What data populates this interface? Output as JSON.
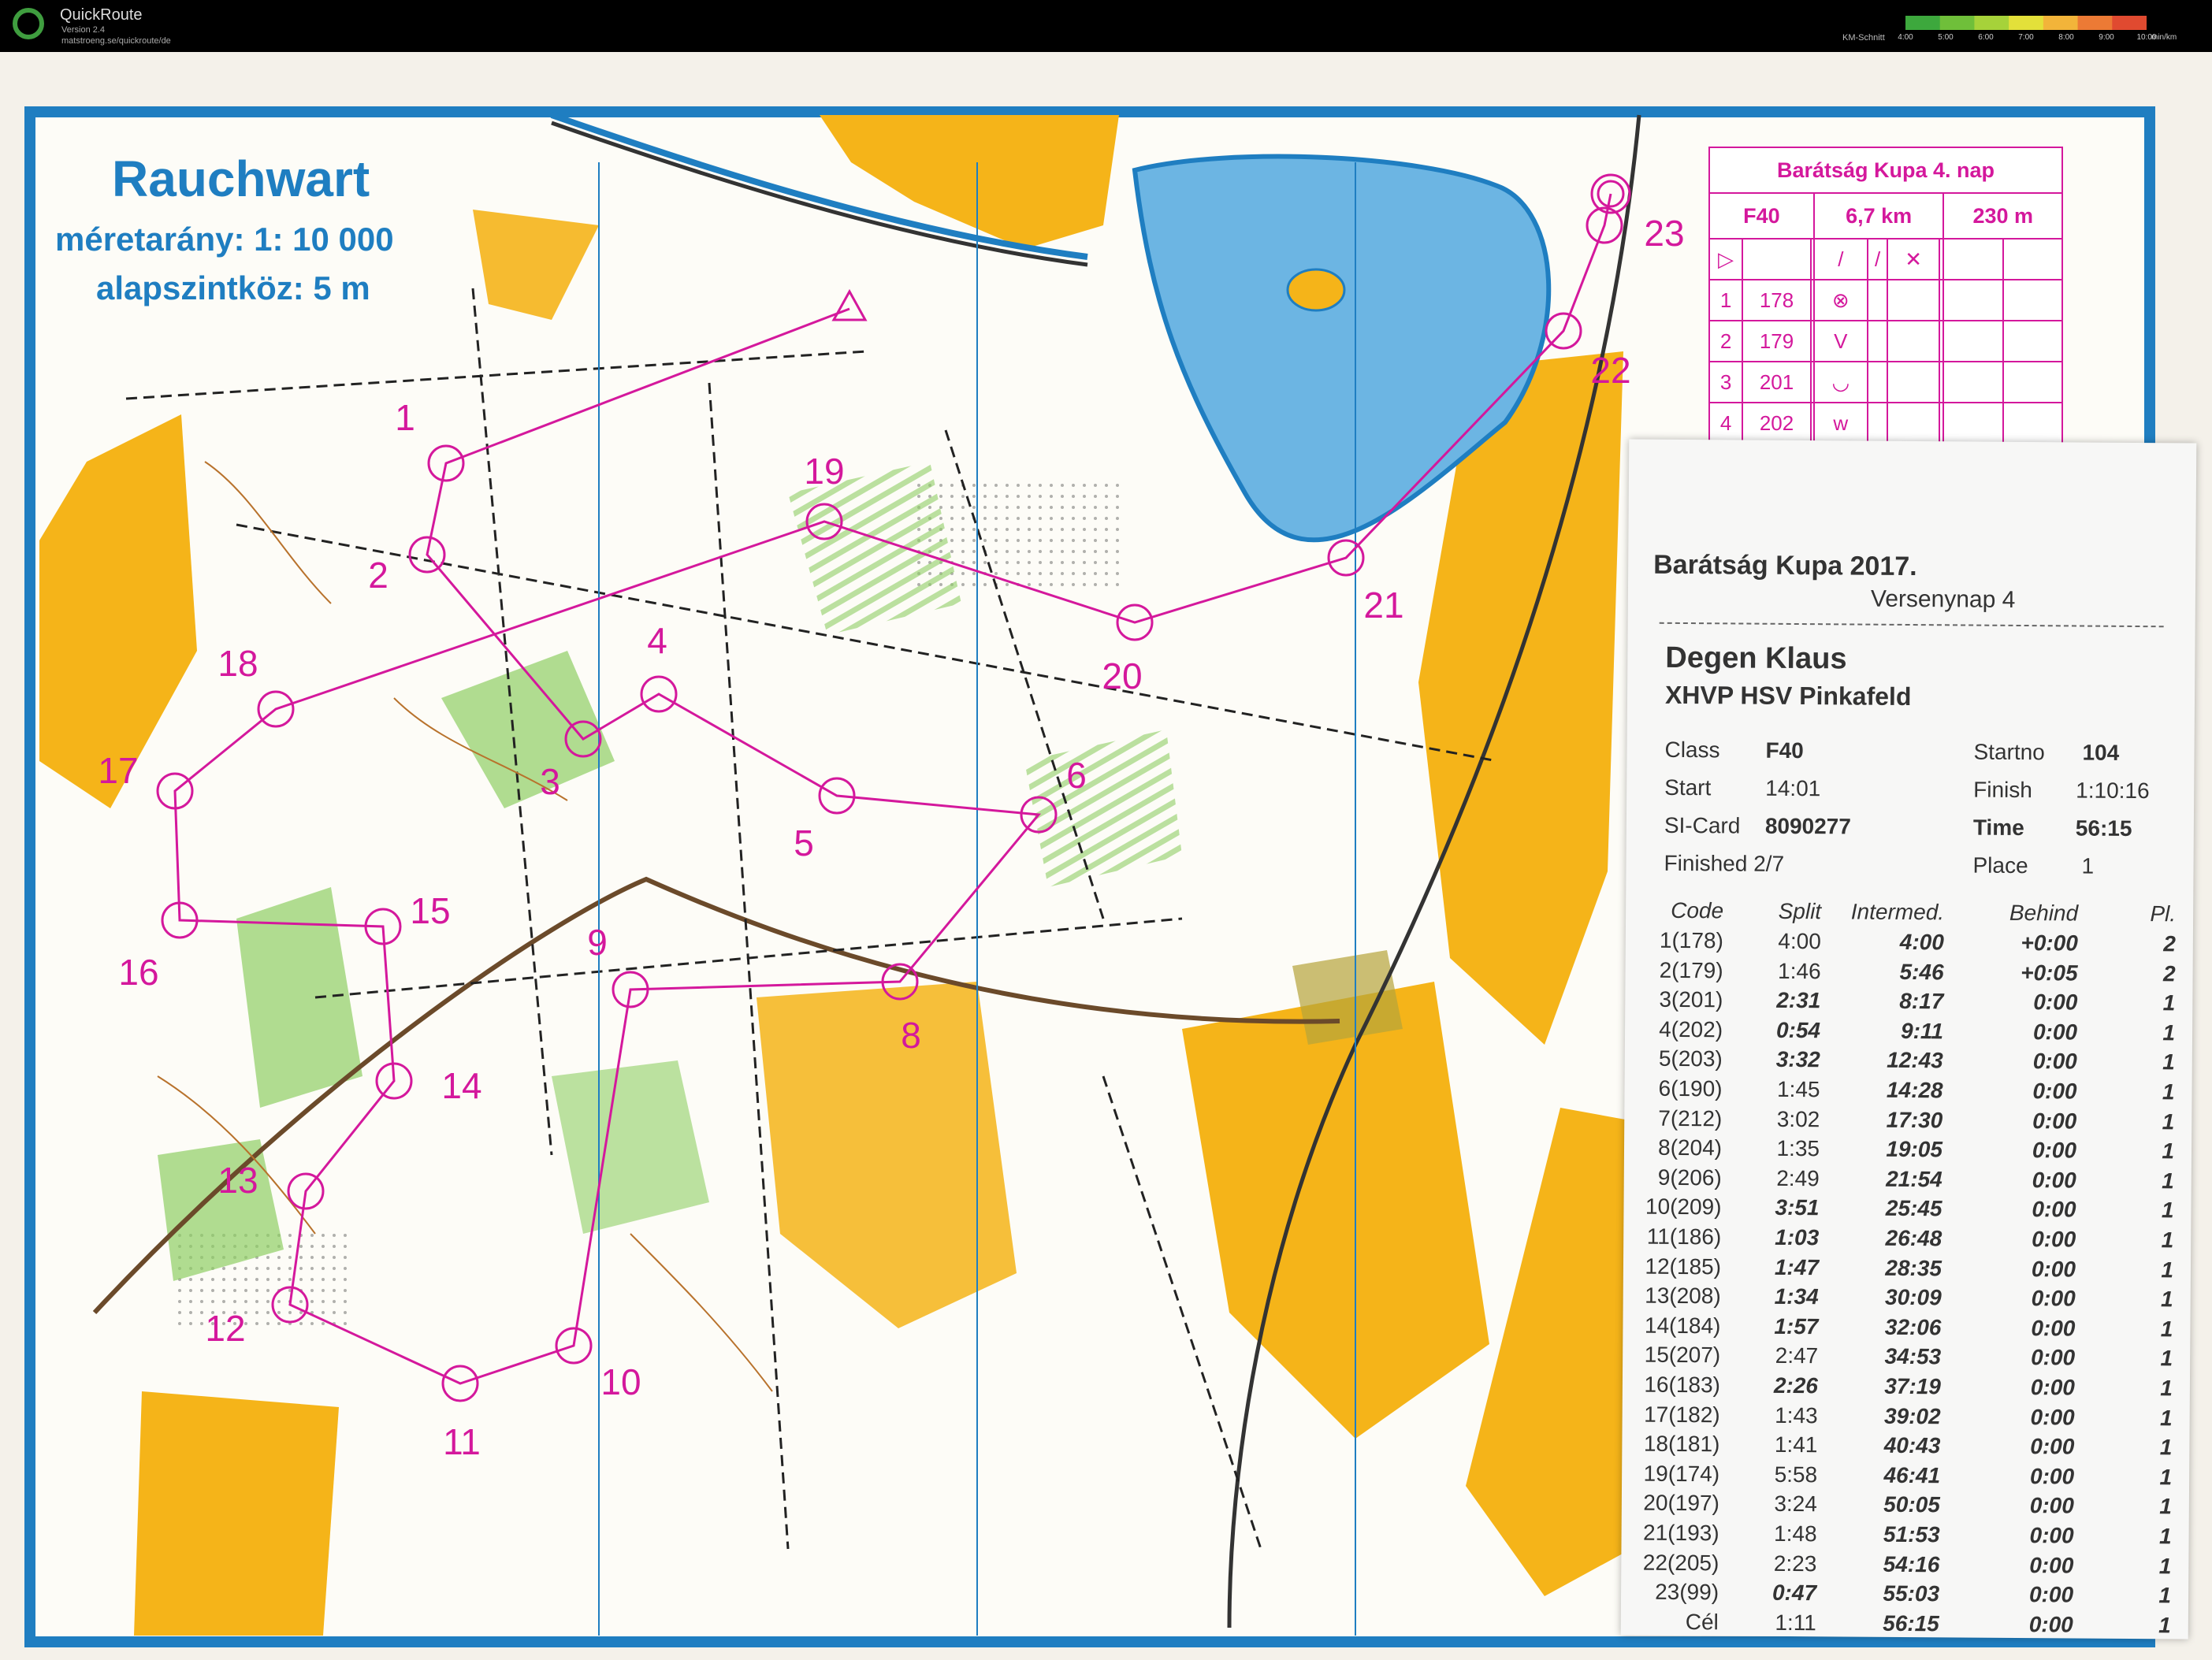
{
  "app": {
    "name": "QuickRoute",
    "version": "Version 2.4",
    "url": "matstroeng.se/quickroute/de",
    "pace_label": "KM-Schnitt",
    "pace_ticks": [
      "4:00",
      "5:00",
      "6:00",
      "7:00",
      "8:00",
      "9:00",
      "10:00"
    ],
    "pace_unit": "min/km",
    "pace_colors": [
      "#3da83d",
      "#6fbf3a",
      "#a6d23a",
      "#e3e03a",
      "#f2b43a",
      "#ec7a35",
      "#e04a30"
    ]
  },
  "map": {
    "title": "Rauchwart",
    "scale": "méretarány: 1: 10 000",
    "contour": "alapszintköz: 5 m",
    "colors": {
      "overprint": "#d4189c",
      "open": "#f5b419",
      "forest": "#8fce64",
      "water": "#6cb5e3",
      "frame": "#1f7ec1"
    },
    "controls": [
      "1",
      "2",
      "3",
      "4",
      "5",
      "6",
      "8",
      "9",
      "10",
      "11",
      "12",
      "13",
      "14",
      "15",
      "16",
      "17",
      "18",
      "19",
      "20",
      "21",
      "22",
      "23"
    ]
  },
  "description": {
    "title": "Barátság Kupa 4. nap",
    "class": "F40",
    "length": "6,7 km",
    "climb": "230 m",
    "rows": [
      {
        "n": "1",
        "code": "178",
        "sym": "⊗"
      },
      {
        "n": "2",
        "code": "179",
        "sym": "V"
      },
      {
        "n": "3",
        "code": "201",
        "sym": "◡"
      },
      {
        "n": "4",
        "code": "202",
        "sym": "ᴡ"
      }
    ]
  },
  "slip": {
    "event": "Barátság Kupa 2017.",
    "day": "Versenynap 4",
    "name": "Degen Klaus",
    "club": "XHVP HSV Pinkafeld",
    "class_label": "Class",
    "class_value": "F40",
    "startno_label": "Startno",
    "startno_value": "104",
    "start_label": "Start",
    "start_value": "14:01",
    "finish_label": "Finish",
    "finish_value": "1:10:16",
    "sicard_label": "SI-Card",
    "sicard_value": "8090277",
    "time_label": "Time",
    "time_value": "56:15",
    "finished": "Finished 2/7",
    "place_label": "Place",
    "place_value": "1",
    "headers": {
      "code": "Code",
      "split": "Split",
      "intermed": "Intermed.",
      "behind": "Behind",
      "pl": "Pl."
    },
    "splits": [
      {
        "code": "1(178)",
        "split": "4:00",
        "inter": "4:00",
        "behind": "+0:00",
        "pl": "2",
        "bold": false
      },
      {
        "code": "2(179)",
        "split": "1:46",
        "inter": "5:46",
        "behind": "+0:05",
        "pl": "2",
        "bold": false
      },
      {
        "code": "3(201)",
        "split": "2:31",
        "inter": "8:17",
        "behind": "0:00",
        "pl": "1",
        "bold": true
      },
      {
        "code": "4(202)",
        "split": "0:54",
        "inter": "9:11",
        "behind": "0:00",
        "pl": "1",
        "bold": true
      },
      {
        "code": "5(203)",
        "split": "3:32",
        "inter": "12:43",
        "behind": "0:00",
        "pl": "1",
        "bold": true
      },
      {
        "code": "6(190)",
        "split": "1:45",
        "inter": "14:28",
        "behind": "0:00",
        "pl": "1",
        "bold": false
      },
      {
        "code": "7(212)",
        "split": "3:02",
        "inter": "17:30",
        "behind": "0:00",
        "pl": "1",
        "bold": false
      },
      {
        "code": "8(204)",
        "split": "1:35",
        "inter": "19:05",
        "behind": "0:00",
        "pl": "1",
        "bold": false
      },
      {
        "code": "9(206)",
        "split": "2:49",
        "inter": "21:54",
        "behind": "0:00",
        "pl": "1",
        "bold": false
      },
      {
        "code": "10(209)",
        "split": "3:51",
        "inter": "25:45",
        "behind": "0:00",
        "pl": "1",
        "bold": true
      },
      {
        "code": "11(186)",
        "split": "1:03",
        "inter": "26:48",
        "behind": "0:00",
        "pl": "1",
        "bold": true
      },
      {
        "code": "12(185)",
        "split": "1:47",
        "inter": "28:35",
        "behind": "0:00",
        "pl": "1",
        "bold": true
      },
      {
        "code": "13(208)",
        "split": "1:34",
        "inter": "30:09",
        "behind": "0:00",
        "pl": "1",
        "bold": true
      },
      {
        "code": "14(184)",
        "split": "1:57",
        "inter": "32:06",
        "behind": "0:00",
        "pl": "1",
        "bold": true
      },
      {
        "code": "15(207)",
        "split": "2:47",
        "inter": "34:53",
        "behind": "0:00",
        "pl": "1",
        "bold": false
      },
      {
        "code": "16(183)",
        "split": "2:26",
        "inter": "37:19",
        "behind": "0:00",
        "pl": "1",
        "bold": true
      },
      {
        "code": "17(182)",
        "split": "1:43",
        "inter": "39:02",
        "behind": "0:00",
        "pl": "1",
        "bold": false
      },
      {
        "code": "18(181)",
        "split": "1:41",
        "inter": "40:43",
        "behind": "0:00",
        "pl": "1",
        "bold": false
      },
      {
        "code": "19(174)",
        "split": "5:58",
        "inter": "46:41",
        "behind": "0:00",
        "pl": "1",
        "bold": false
      },
      {
        "code": "20(197)",
        "split": "3:24",
        "inter": "50:05",
        "behind": "0:00",
        "pl": "1",
        "bold": false
      },
      {
        "code": "21(193)",
        "split": "1:48",
        "inter": "51:53",
        "behind": "0:00",
        "pl": "1",
        "bold": false
      },
      {
        "code": "22(205)",
        "split": "2:23",
        "inter": "54:16",
        "behind": "0:00",
        "pl": "1",
        "bold": false
      },
      {
        "code": "23(99)",
        "split": "0:47",
        "inter": "55:03",
        "behind": "0:00",
        "pl": "1",
        "bold": true
      },
      {
        "code": "Cél",
        "split": "1:11",
        "inter": "56:15",
        "behind": "0:00",
        "pl": "1",
        "bold": false
      }
    ]
  }
}
